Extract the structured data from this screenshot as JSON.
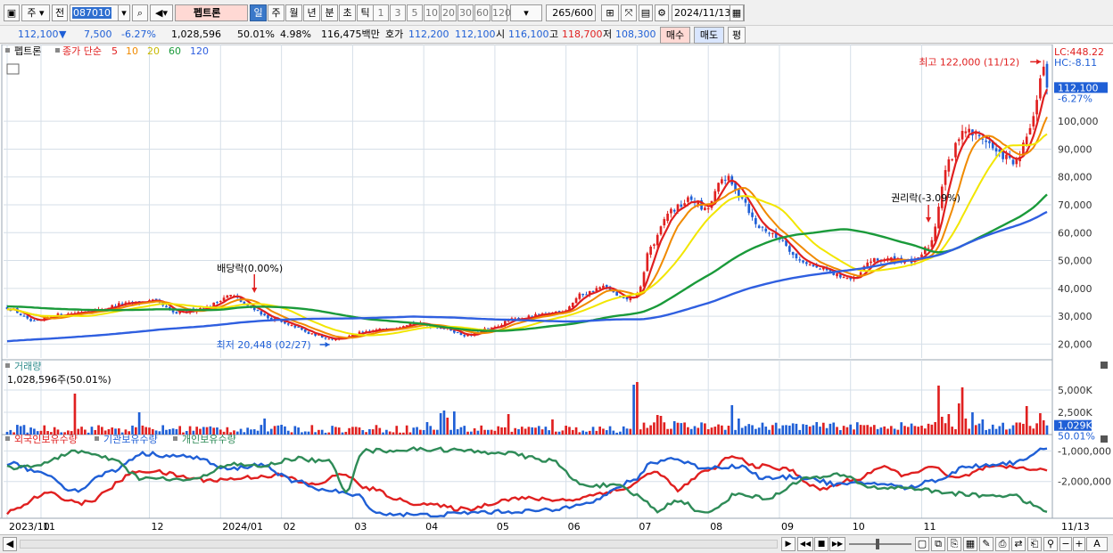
{
  "toolbar": {
    "mode": "주",
    "prefix": "전",
    "code": "087010",
    "name": "펩트론",
    "periods": [
      "일",
      "주",
      "월",
      "년",
      "분",
      "초",
      "틱"
    ],
    "active_period": "일",
    "intervals": [
      "1",
      "3",
      "5",
      "10",
      "20",
      "30",
      "60",
      "120"
    ],
    "count": "265",
    "count_total": "/600",
    "date": "2024/11/13"
  },
  "quote": {
    "price": "112,100",
    "change": "7,500",
    "change_rate": "-6.27%",
    "volume": "1,028,596",
    "volume_ratio": "50.01%",
    "turnover_rate": "4.98%",
    "amount": "116,475백만",
    "bid_ask_label": "호가",
    "ask": "112,200",
    "bid": "112,100",
    "open_label": "시",
    "open": "116,100",
    "high_label": "고",
    "high": "118,700",
    "low_label": "저",
    "low": "108,300",
    "buy_button": "매수",
    "sell_button": "매도",
    "eval_button": "평"
  },
  "colors": {
    "up": "#e02020",
    "down": "#1f5fd6",
    "ma5": "#e02020",
    "ma10": "#f08a00",
    "ma20": "#f2e600",
    "ma60": "#1a9a3a",
    "ma120": "#2f5fe0",
    "grid": "#d6dfe8"
  },
  "price_panel": {
    "legend_name": "펩트론",
    "legend_title": "종가 단순",
    "ma_labels": [
      "5",
      "10",
      "20",
      "60",
      "120"
    ],
    "lc_label": "LC:448.22",
    "hc_label": "HC:-8.11",
    "last_price_tag": "112,100",
    "last_change_tag": "-6.27%",
    "high_annotation": "최고 122,000 (11/12)",
    "low_annotation": "최저 20,448 (02/27)",
    "event_dividend": "배당락(0.00%)",
    "event_rights": "권리락(-3.09%)"
  },
  "volume_panel": {
    "title": "거래량",
    "value_text": "1,028,596주(50.01%)",
    "last_tag": "1,029K",
    "last_ratio_tag": "50.01%"
  },
  "holdings_panel": {
    "labels": [
      "외국인보유수량",
      "기관보유수량",
      "개인보유수량"
    ],
    "colors": [
      "#e02020",
      "#1f5fd6",
      "#2e8b57"
    ]
  },
  "chart_data": [
    {
      "type": "candlestick",
      "title": "펩트론",
      "ylim": [
        15000,
        125000
      ],
      "yticks": [
        20000,
        30000,
        40000,
        50000,
        60000,
        70000,
        80000,
        90000,
        100000
      ],
      "ytick_labels": [
        "20,000",
        "30,000",
        "40,000",
        "50,000",
        "60,000",
        "70,000",
        "80,000",
        "90,000",
        "100,000"
      ],
      "x_labels": [
        "2023/10",
        "11",
        "12",
        "2024/01",
        "02",
        "03",
        "04",
        "05",
        "06",
        "07",
        "08",
        "09",
        "10",
        "11",
        "11/13"
      ],
      "x_label_days": [
        0,
        10,
        42,
        63,
        81,
        102,
        123,
        144,
        165,
        186,
        207,
        228,
        249,
        270,
        291
      ],
      "anchors": [
        [
          0,
          33000
        ],
        [
          8,
          28000
        ],
        [
          15,
          30500
        ],
        [
          25,
          32000
        ],
        [
          35,
          34500
        ],
        [
          43,
          35500
        ],
        [
          50,
          31000
        ],
        [
          58,
          33000
        ],
        [
          66,
          37500
        ],
        [
          72,
          33000
        ],
        [
          78,
          29000
        ],
        [
          84,
          26500
        ],
        [
          90,
          23500
        ],
        [
          96,
          21800
        ],
        [
          100,
          22500
        ],
        [
          104,
          24000
        ],
        [
          112,
          25500
        ],
        [
          120,
          27500
        ],
        [
          128,
          26000
        ],
        [
          136,
          23000
        ],
        [
          142,
          25500
        ],
        [
          150,
          29000
        ],
        [
          158,
          30500
        ],
        [
          164,
          32000
        ],
        [
          170,
          38000
        ],
        [
          176,
          40500
        ],
        [
          182,
          36000
        ],
        [
          186,
          37500
        ],
        [
          190,
          55000
        ],
        [
          196,
          68000
        ],
        [
          202,
          72000
        ],
        [
          206,
          68000
        ],
        [
          212,
          80000
        ],
        [
          216,
          74000
        ],
        [
          222,
          62000
        ],
        [
          228,
          58000
        ],
        [
          234,
          50000
        ],
        [
          240,
          47000
        ],
        [
          246,
          44500
        ],
        [
          250,
          43000
        ],
        [
          255,
          50000
        ],
        [
          262,
          50500
        ],
        [
          268,
          49500
        ],
        [
          272,
          55000
        ],
        [
          278,
          85000
        ],
        [
          282,
          97000
        ],
        [
          288,
          94000
        ],
        [
          293,
          88000
        ],
        [
          298,
          85000
        ],
        [
          302,
          97000
        ],
        [
          306,
          120000
        ],
        [
          307,
          112100
        ]
      ],
      "moving_averages": [
        5,
        10,
        20,
        60,
        120
      ],
      "last_close": 112100,
      "high": {
        "value": 122000,
        "date": "11/12"
      },
      "low": {
        "value": 20448,
        "date": "02/27"
      }
    },
    {
      "type": "bar",
      "title": "거래량",
      "ylim": [
        0,
        7000
      ],
      "yticks": [
        2500,
        5000
      ],
      "ytick_labels": [
        "2,500K",
        "5,000K"
      ],
      "last_value": 1029,
      "spikes": [
        [
          20,
          4600
        ],
        [
          39,
          2500
        ],
        [
          76,
          1800
        ],
        [
          124,
          1400
        ],
        [
          128,
          2400
        ],
        [
          129,
          2700
        ],
        [
          130,
          1900
        ],
        [
          132,
          2600
        ],
        [
          148,
          2300
        ],
        [
          161,
          1700
        ],
        [
          185,
          5600
        ],
        [
          186,
          5900
        ],
        [
          192,
          2200
        ],
        [
          193,
          2100
        ],
        [
          197,
          1500
        ],
        [
          214,
          3300
        ],
        [
          216,
          1800
        ],
        [
          275,
          5500
        ],
        [
          276,
          2000
        ],
        [
          278,
          2300
        ],
        [
          281,
          3500
        ],
        [
          282,
          5300
        ],
        [
          283,
          1800
        ],
        [
          285,
          2500
        ],
        [
          288,
          1700
        ],
        [
          301,
          3200
        ],
        [
          305,
          2400
        ],
        [
          306,
          1600
        ]
      ]
    },
    {
      "type": "line",
      "title": "보유수량",
      "ylim": [
        -3200000,
        -700000
      ],
      "yticks": [
        -1000000,
        -2000000
      ],
      "ytick_labels": [
        "-1,000,000",
        "-2,000,000"
      ],
      "series": [
        {
          "name": "외국인보유수량",
          "anchors": [
            [
              0,
              -3000000
            ],
            [
              12,
              -2400000
            ],
            [
              22,
              -2700000
            ],
            [
              40,
              -1650000
            ],
            [
              60,
              -1950000
            ],
            [
              80,
              -1800000
            ],
            [
              90,
              -2100000
            ],
            [
              100,
              -1750000
            ],
            [
              105,
              -2200000
            ],
            [
              120,
              -2700000
            ],
            [
              135,
              -2900000
            ],
            [
              150,
              -2550000
            ],
            [
              165,
              -2600000
            ],
            [
              180,
              -2300000
            ],
            [
              192,
              -1700000
            ],
            [
              198,
              -2250000
            ],
            [
              206,
              -1700000
            ],
            [
              214,
              -1200000
            ],
            [
              222,
              -1500000
            ],
            [
              230,
              -1600000
            ],
            [
              240,
              -2250000
            ],
            [
              250,
              -1950000
            ],
            [
              258,
              -1550000
            ],
            [
              266,
              -1800000
            ],
            [
              272,
              -1500000
            ],
            [
              280,
              -1900000
            ],
            [
              290,
              -1550000
            ],
            [
              300,
              -1550000
            ],
            [
              307,
              -1650000
            ]
          ]
        },
        {
          "name": "기관보유수량",
          "anchors": [
            [
              0,
              -1400000
            ],
            [
              10,
              -1700000
            ],
            [
              20,
              -2300000
            ],
            [
              30,
              -1700000
            ],
            [
              40,
              -1100000
            ],
            [
              55,
              -1200000
            ],
            [
              65,
              -1600000
            ],
            [
              75,
              -1450000
            ],
            [
              85,
              -2000000
            ],
            [
              95,
              -2300000
            ],
            [
              103,
              -2450000
            ],
            [
              110,
              -3050000
            ],
            [
              125,
              -3100000
            ],
            [
              140,
              -3000000
            ],
            [
              160,
              -2950000
            ],
            [
              172,
              -2650000
            ],
            [
              185,
              -2000000
            ],
            [
              190,
              -1400000
            ],
            [
              196,
              -1250000
            ],
            [
              206,
              -1550000
            ],
            [
              216,
              -1500000
            ],
            [
              224,
              -1900000
            ],
            [
              234,
              -1850000
            ],
            [
              246,
              -2100000
            ],
            [
              256,
              -2050000
            ],
            [
              266,
              -2200000
            ],
            [
              274,
              -1950000
            ],
            [
              284,
              -1500000
            ],
            [
              296,
              -1400000
            ],
            [
              307,
              -950000
            ]
          ]
        },
        {
          "name": "개인보유수량",
          "anchors": [
            [
              0,
              -1550000
            ],
            [
              10,
              -1450000
            ],
            [
              20,
              -1000000
            ],
            [
              30,
              -1250000
            ],
            [
              40,
              -1900000
            ],
            [
              55,
              -1950000
            ],
            [
              65,
              -1450000
            ],
            [
              75,
              -1500000
            ],
            [
              85,
              -1250000
            ],
            [
              95,
              -1350000
            ],
            [
              100,
              -2300000
            ],
            [
              105,
              -1000000
            ],
            [
              125,
              -950000
            ],
            [
              145,
              -1050000
            ],
            [
              160,
              -1300000
            ],
            [
              170,
              -2100000
            ],
            [
              180,
              -2150000
            ],
            [
              186,
              -2450000
            ],
            [
              192,
              -2950000
            ],
            [
              198,
              -2600000
            ],
            [
              206,
              -3050000
            ],
            [
              216,
              -2400000
            ],
            [
              224,
              -2550000
            ],
            [
              236,
              -1900000
            ],
            [
              246,
              -1800000
            ],
            [
              256,
              -2200000
            ],
            [
              266,
              -2200000
            ],
            [
              276,
              -2350000
            ],
            [
              286,
              -2450000
            ],
            [
              296,
              -2450000
            ],
            [
              307,
              -2950000
            ]
          ]
        }
      ]
    }
  ],
  "bottom": {
    "nav_buttons": [
      "▶",
      "◀◀",
      "■",
      "▶▶"
    ]
  }
}
